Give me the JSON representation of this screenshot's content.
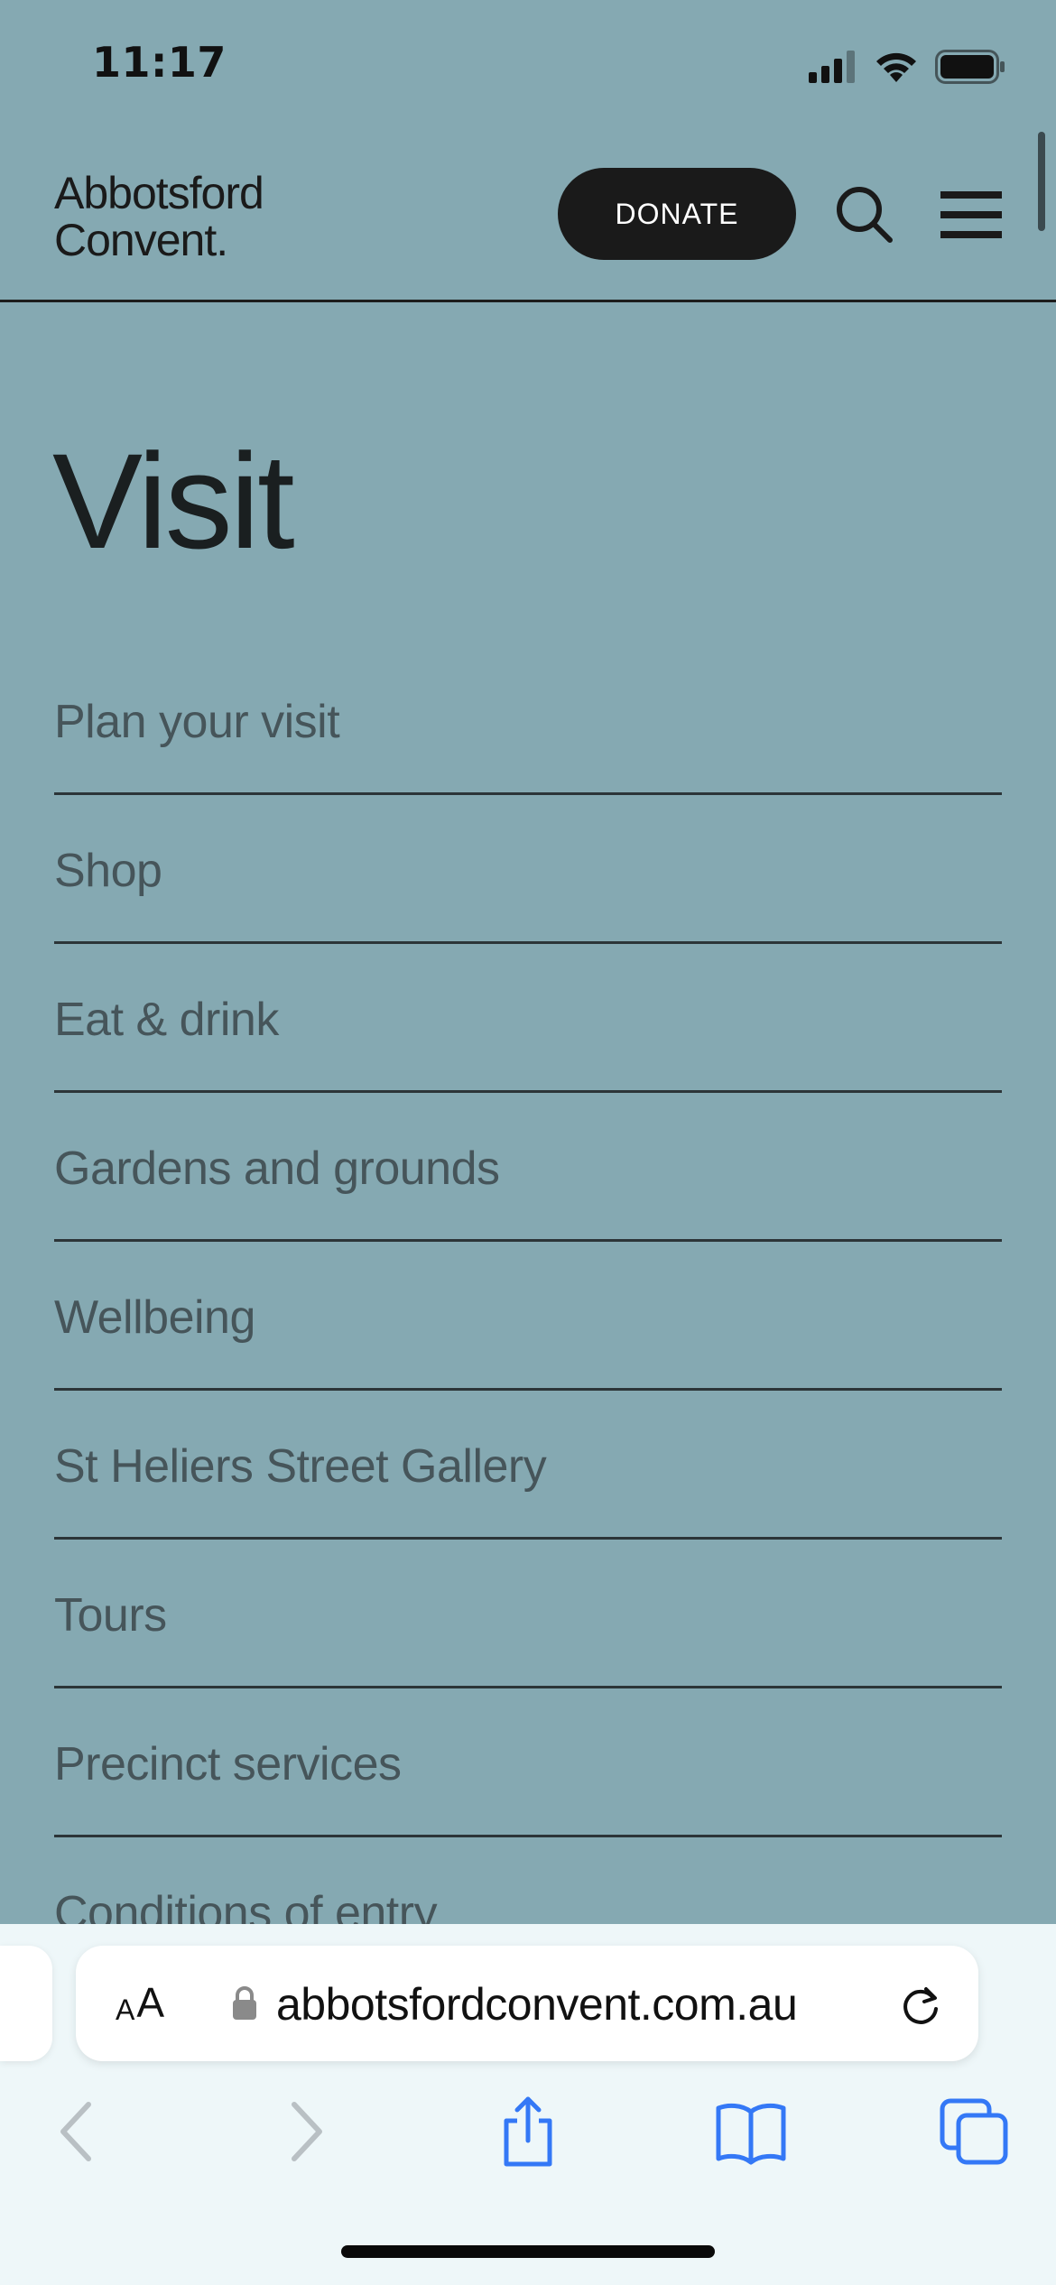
{
  "status_bar": {
    "time": "11:17",
    "signal_icon": "cellular-signal-icon",
    "wifi_icon": "wifi-icon",
    "battery_icon": "battery-icon"
  },
  "header": {
    "logo_line1": "Abbotsford",
    "logo_line2": "Convent.",
    "donate_label": "DONATE",
    "search_icon": "search-icon",
    "menu_icon": "hamburger-menu-icon"
  },
  "page": {
    "title": "Visit",
    "nav_items": [
      {
        "label": "Plan your visit"
      },
      {
        "label": "Shop"
      },
      {
        "label": "Eat & drink"
      },
      {
        "label": "Gardens and grounds"
      },
      {
        "label": "Wellbeing"
      },
      {
        "label": "St Heliers Street Gallery"
      },
      {
        "label": "Tours"
      },
      {
        "label": "Precinct services"
      },
      {
        "label": "Conditions of entry"
      }
    ]
  },
  "browser": {
    "aa_small": "A",
    "aa_big": "A",
    "url": "abbotsfordconvent.com.au",
    "toolbar_icons": [
      "back-icon",
      "forward-icon",
      "share-icon",
      "bookmarks-icon",
      "tabs-icon"
    ]
  },
  "colors": {
    "background": "#85a9b2",
    "text_dark": "#1a1a1a",
    "nav_text": "#46555a",
    "safari_accent": "#3478f6"
  }
}
